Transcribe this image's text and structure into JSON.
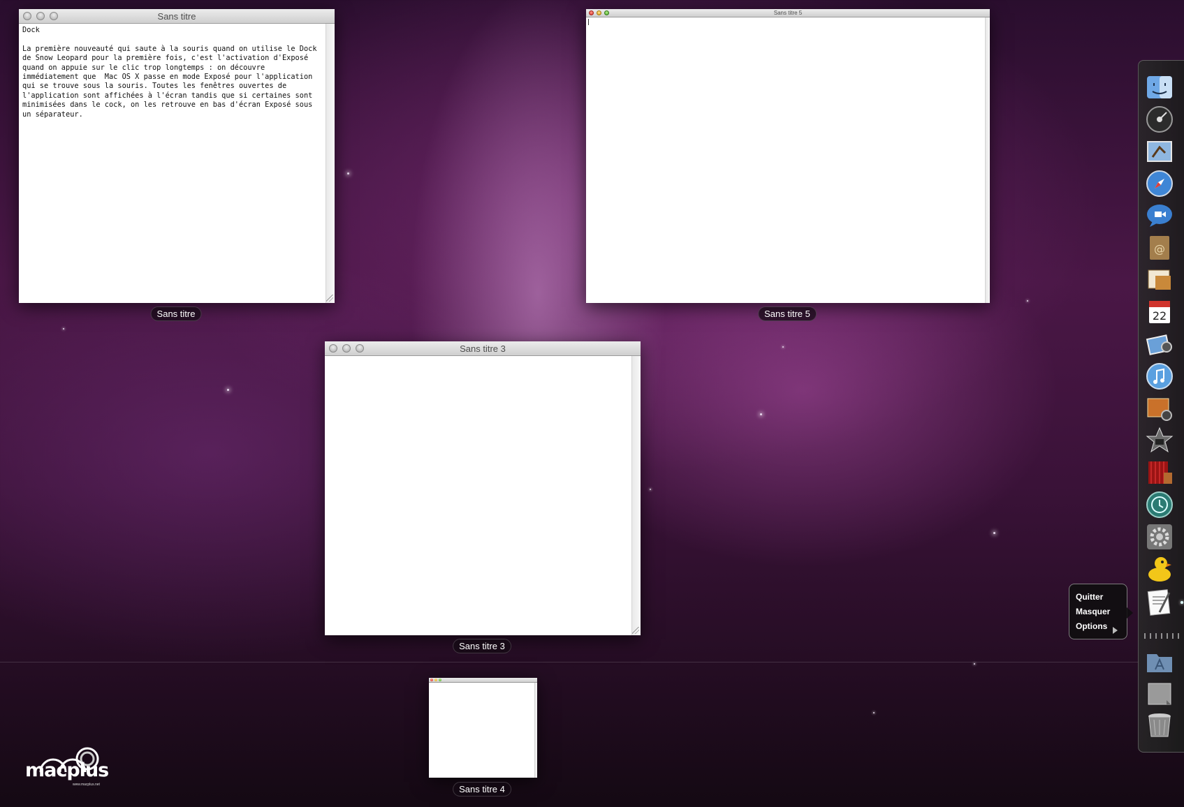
{
  "windows": {
    "sans_titre": {
      "title": "Sans titre",
      "label": "Sans titre",
      "text": "Dock\n\nLa première nouveauté qui saute à la souris quand on utilise le Dock de Snow Leopard pour la première fois, c'est l'activation d'Exposé quand on appuie sur le clic trop longtemps : on découvre immédiatement que  Mac OS X passe en mode Exposé pour l'application qui se trouve sous la souris. Toutes les fenêtres ouvertes de l'application sont affichées à l'écran tandis que si certaines sont minimisées dans le cock, on les retrouve en bas d'écran Exposé sous un séparateur."
    },
    "sans_titre_5": {
      "title": "Sans titre 5",
      "label": "Sans titre 5"
    },
    "sans_titre_3": {
      "title": "Sans titre 3",
      "label": "Sans titre 3"
    },
    "sans_titre_4": {
      "title": "Sans titre 4",
      "label": "Sans titre 4"
    }
  },
  "context_menu": {
    "items": [
      {
        "label": "Quitter"
      },
      {
        "label": "Masquer"
      },
      {
        "label": "Options",
        "has_submenu": true
      }
    ]
  },
  "dock": {
    "items": [
      "finder-icon",
      "dashboard-icon",
      "mail-icon",
      "safari-icon",
      "ichat-icon",
      "address-book-icon",
      "preview-icon",
      "ical-icon",
      "iphoto-icon",
      "itunes-icon",
      "photo-booth-icon",
      "imovie-icon",
      "front-row-icon",
      "time-machine-icon",
      "system-preferences-icon",
      "cyberduck-icon",
      "textedit-icon",
      "applications-folder-icon",
      "documents-stack-icon",
      "trash-icon"
    ]
  },
  "logo": {
    "text": "macplus",
    "url": "www.macplus.net"
  },
  "colors": {
    "menu_bg": "#0f0f0f",
    "label_bg": "#140a14",
    "wallpaper_accent": "#6a2566"
  }
}
